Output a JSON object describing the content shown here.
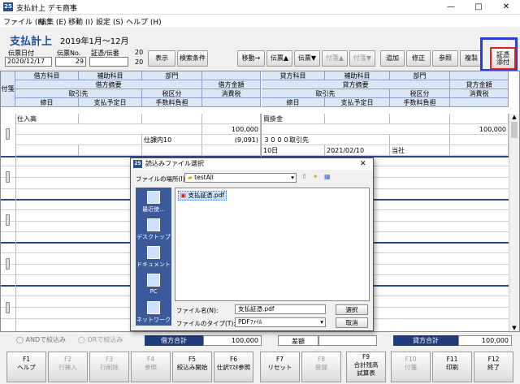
{
  "window": {
    "title": "支払計上 デモ商事",
    "min": "—",
    "max": "□",
    "close": "✕"
  },
  "menu": [
    "ファイル (F)",
    "編集 (E)",
    "移動 (I)",
    "設定 (S)",
    "ヘルプ (H)"
  ],
  "page": {
    "title": "支払計上",
    "period": "2019年1月～12月"
  },
  "fields": {
    "date_label": "伝票日付",
    "date_value": "2020/12/17",
    "no_label": "伝票No.",
    "no_value": "29",
    "proof_label": "証憑/伝番",
    "proof_value": "",
    "year_top": "20",
    "year_bottom": "20"
  },
  "toolbar": {
    "display": "表示",
    "search": "検索条件",
    "move": "移動→",
    "slip_up": "伝票▲",
    "slip_down": "伝票▼",
    "tag_up": "付箋▲",
    "tag_down": "付箋▼",
    "add": "追加",
    "edit": "修正",
    "ref": "参照",
    "copy": "複製",
    "attach_1": "証憑",
    "attach_2": "添付"
  },
  "grid": {
    "tag_col": "付箋",
    "h_debit": [
      "借方科目",
      "補助科目",
      "部門"
    ],
    "h_debit2": [
      "借方摘要",
      "借方金額"
    ],
    "h_debit3": [
      "取引先",
      "税区分",
      "消費税"
    ],
    "h_debit4": [
      "締日",
      "支払予定日",
      "手数料負担"
    ],
    "h_credit": [
      "貸方科目",
      "補助科目",
      "部門"
    ],
    "h_credit2": [
      "貸方摘要",
      "貸方金額"
    ],
    "h_credit3": [
      "取引先",
      "税区分",
      "消費税"
    ],
    "h_credit4": [
      "締日",
      "支払予定日",
      "手数料負担"
    ],
    "row": {
      "debit_account": "仕入高",
      "debit_amount": "100,000",
      "debit_tax_class": "仕課内10",
      "debit_tax": "(9,091)",
      "credit_account": "買掛金",
      "credit_amount": "100,000",
      "credit_partner": "３０００取引先",
      "credit_close": "10日",
      "credit_pay_date": "2021/02/10",
      "credit_fee": "当社"
    }
  },
  "filter": {
    "and_label": "ANDで絞込み",
    "or_label": "ORで絞込み"
  },
  "totals": {
    "debit_label": "借方合計",
    "debit_value": "100,000",
    "diff_label": "差額",
    "diff_value": "",
    "credit_label": "貸方合計",
    "credit_value": "100,000"
  },
  "fkeys": [
    {
      "k": "F1",
      "l": "ヘルプ",
      "l2": ""
    },
    {
      "k": "F2",
      "l": "行挿入",
      "l2": ""
    },
    {
      "k": "F3",
      "l": "行削除",
      "l2": ""
    },
    {
      "k": "F4",
      "l": "参照",
      "l2": ""
    },
    {
      "k": "F5",
      "l": "絞込み開始",
      "l2": ""
    },
    {
      "k": "F6",
      "l": "仕訳ﾏｽﾀ参照",
      "l2": ""
    },
    {
      "k": "F7",
      "l": "リセット",
      "l2": ""
    },
    {
      "k": "F8",
      "l": "登録",
      "l2": ""
    },
    {
      "k": "F9",
      "l": "合計残高",
      "l2": "試算表"
    },
    {
      "k": "F10",
      "l": "付箋",
      "l2": ""
    },
    {
      "k": "F11",
      "l": "印刷",
      "l2": ""
    },
    {
      "k": "F12",
      "l": "終了",
      "l2": ""
    }
  ],
  "dialog": {
    "title": "読込みファイル選択",
    "look_in_label": "ファイルの場所(I):",
    "look_in_value": "testAll",
    "places": [
      "最近使...",
      "デスクトップ",
      "ドキュメント",
      "PC",
      "ネットワーク"
    ],
    "file": "支払証憑.pdf",
    "filename_label": "ファイル名(N):",
    "filename_value": "支払証憑.pdf",
    "filetype_label": "ファイルのタイプ(T):",
    "filetype_value": "PDFﾌｧｲﾙ",
    "select": "選択",
    "cancel": "取消",
    "close": "✕"
  },
  "colors": {
    "accent": "#1f4e9a",
    "highlight_blue": "#2a3fcf",
    "highlight_red": "#e02020"
  }
}
